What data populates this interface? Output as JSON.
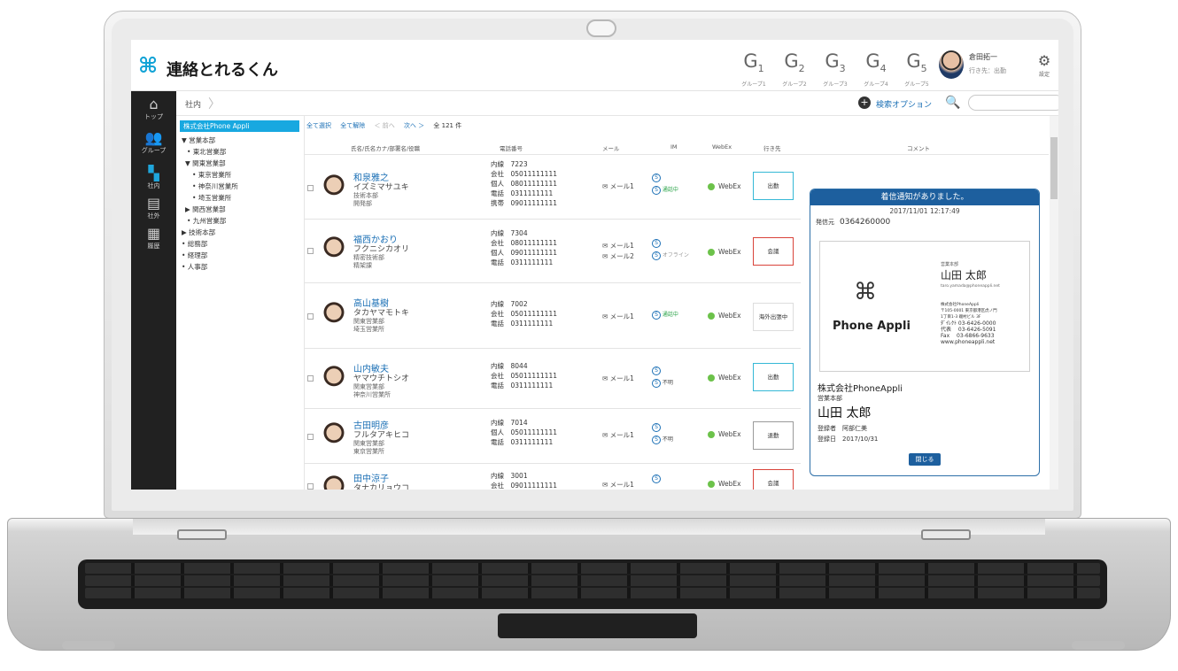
{
  "app": {
    "title": "連絡とれるくん"
  },
  "groups": [
    {
      "label": "G",
      "num": "1",
      "sub": "グループ1"
    },
    {
      "label": "G",
      "num": "2",
      "sub": "グループ2"
    },
    {
      "label": "G",
      "num": "3",
      "sub": "グループ3"
    },
    {
      "label": "G",
      "num": "4",
      "sub": "グループ4"
    },
    {
      "label": "G",
      "num": "5",
      "sub": "グループ5"
    }
  ],
  "user": {
    "name": "倉田拓一",
    "status": "行き先：出勤"
  },
  "settings_label": "設定",
  "sidebar": {
    "items": [
      {
        "label": "トップ"
      },
      {
        "label": "グループ"
      },
      {
        "label": "社内"
      },
      {
        "label": "社外"
      },
      {
        "label": "履歴"
      }
    ]
  },
  "breadcrumb": "社内",
  "search": {
    "options_label": "検索オプション",
    "button": "検索",
    "placeholder": ""
  },
  "tree": {
    "root": "株式会社Phone Appli",
    "nodes": [
      "▼ 営業本部",
      "• 東北営業部",
      "▼ 関東営業部",
      "• 東京営業所",
      "• 神奈川営業所",
      "• 埼玉営業所",
      "▶ 関西営業部",
      "• 九州営業部",
      "▶ 技術本部",
      "• 総務部",
      "• 経理部",
      "• 人事部"
    ]
  },
  "toolbar": {
    "select_all": "全て選択",
    "deselect_all": "全て解除",
    "prev": "＜ 前へ",
    "next": "次へ ＞",
    "count": "全 121 件"
  },
  "columns": {
    "name": "氏名/氏名カナ/部署名/役職",
    "phone": "電話番号",
    "mail": "メール",
    "im": "IM",
    "webex": "WebEx",
    "status": "行き先",
    "comment": "コメント"
  },
  "people": [
    {
      "name": "和泉雅之",
      "kana": "イズミマサユキ",
      "dept": "技術本部",
      "title": "開発部",
      "phones": [
        "内線　7223",
        "会社　05011111111",
        "個人　08011111111",
        "電話　0311111111",
        "携帯　09011111111"
      ],
      "mails": [
        "メール1"
      ],
      "im": "通話中",
      "webex": "WebEx",
      "status": "出勤"
    },
    {
      "name": "福西かおり",
      "kana": "フクニシカオリ",
      "dept": "精密技術部",
      "title": "精架課",
      "phones": [
        "内線　7304",
        "会社　08011111111",
        "個人　09011111111",
        "電話　0311111111"
      ],
      "mails": [
        "メール1",
        "メール2"
      ],
      "im": "オフライン",
      "webex": "WebEx",
      "status": "会議"
    },
    {
      "name": "高山基樹",
      "kana": "タカヤマモトキ",
      "dept": "関東営業部",
      "title": "埼玉営業所",
      "phones": [
        "内線　7002",
        "会社　05011111111",
        "電話　0311111111"
      ],
      "mails": [
        "メール1"
      ],
      "im": "通話中",
      "webex": "WebEx",
      "status": "海外出張中"
    },
    {
      "name": "山内敏夫",
      "kana": "ヤマウチトシオ",
      "dept": "関東営業部",
      "title": "神奈川営業所",
      "phones": [
        "内線　8044",
        "会社　05011111111",
        "電話　0311111111"
      ],
      "mails": [
        "メール1"
      ],
      "im": "不明",
      "webex": "WebEx",
      "status": "出勤"
    },
    {
      "name": "古田明彦",
      "kana": "フルタアキヒコ",
      "dept": "関東営業部",
      "title": "東京営業所",
      "phones": [
        "内線　7014",
        "個人　05011111111",
        "電話　0311111111"
      ],
      "mails": [
        "メール1"
      ],
      "im": "不明",
      "webex": "WebEx",
      "status": "退勤"
    },
    {
      "name": "田中涼子",
      "kana": "タナカリョウコ",
      "dept": "",
      "title": "",
      "phones": [
        "内線　3001",
        "会社　09011111111"
      ],
      "mails": [
        "メール1"
      ],
      "im": "",
      "webex": "WebEx",
      "status": "会議"
    }
  ],
  "popup": {
    "title": "着信通知がありました。",
    "time": "2017/11/01 12:17:49",
    "caller_label": "発信元",
    "caller": "0364260000",
    "card": {
      "brand": "Phone Appli",
      "dept": "営業本部",
      "name": "山田 太郎",
      "email": "taro.yamada@phoneappli.net",
      "company": "株式会社PhoneAppli",
      "address1": "〒105-0001 東京都港区虎ノ門",
      "address2": "1丁目1-3 磯村ビル 3F",
      "direct": "ﾀﾞｲﾚｸﾄ  03-6426-0000",
      "tel": "代表　 03-6426-5091",
      "fax": "Fax　  03-6866-9633",
      "web": "www.phoneappli.net"
    },
    "company": "株式会社PhoneAppli",
    "dept": "営業本部",
    "name": "山田 太郎",
    "registrant": "登録者　阿部仁美",
    "registered": "登録日　2017/10/31",
    "close": "閉じる"
  }
}
